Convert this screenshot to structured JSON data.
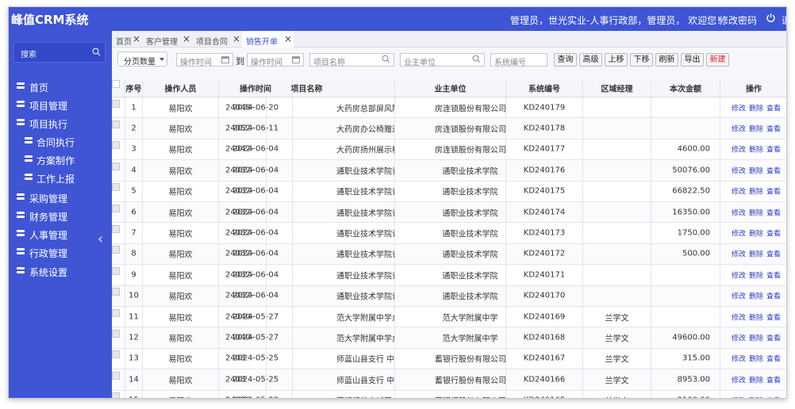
{
  "app": {
    "title": "峰值CRM系统",
    "user_info": "管理员，世光实业-人事行政部，管理员， 欢迎您！",
    "change_password": "修改密码",
    "logout": "退"
  },
  "sidebar": {
    "search_label": "搜索",
    "items": [
      {
        "label": "首页",
        "level": 1
      },
      {
        "label": "项目管理",
        "level": 1
      },
      {
        "label": "项目执行",
        "level": 1
      },
      {
        "label": "合同执行",
        "level": 2
      },
      {
        "label": "方案制作",
        "level": 2
      },
      {
        "label": "工作上报",
        "level": 2
      },
      {
        "label": "采购管理",
        "level": 1
      },
      {
        "label": "财务管理",
        "level": 1
      },
      {
        "label": "人事管理",
        "level": 1
      },
      {
        "label": "行政管理",
        "level": 1
      },
      {
        "label": "系统设置",
        "level": 1
      }
    ]
  },
  "tabs": [
    {
      "label": "首页",
      "active": false
    },
    {
      "label": "客户管理",
      "active": false
    },
    {
      "label": "项目合同",
      "active": false
    },
    {
      "label": "销售开单",
      "active": true
    }
  ],
  "toolbar": {
    "page_size_label": "分页数量",
    "start_time_placeholder": "操作时间",
    "to_label": "到",
    "end_time_placeholder": "操作时间",
    "project_name_placeholder": "项目名称",
    "owner_unit_placeholder": "业主单位",
    "system_code_placeholder": "系统编号",
    "buttons": [
      "查询",
      "高级",
      "上移",
      "下移",
      "刷新",
      "导出",
      "新建"
    ]
  },
  "table": {
    "columns": [
      "序号",
      "操作人员",
      "操作时间",
      "项目名称",
      "业主单位",
      "系统编号",
      "区域经理",
      "本次金额",
      "操作"
    ],
    "actions": [
      "修改",
      "删除",
      "查看"
    ],
    "rows": [
      {
        "no": "1",
        "operator": "易阳欢",
        "time": "2024-06-20",
        "project_code": "24048-",
        "project_name": "大药房总部屏风隔老百",
        "owner": "房连锁股份有限公司",
        "code": "KD240179",
        "manager": "",
        "amount": ""
      },
      {
        "no": "2",
        "operator": "易阳欢",
        "time": "2024-06-11",
        "project_code": "24052-",
        "project_name": "大药房办公椅赠送老百",
        "owner": "房连锁股份有限公司",
        "code": "KD240178",
        "manager": "",
        "amount": ""
      },
      {
        "no": "3",
        "operator": "易阳欢",
        "time": "2024-06-04",
        "project_code": "24042-",
        "project_name": "大药房扬州展示柜老百",
        "owner": "房连锁股份有限公司",
        "code": "KD240177",
        "manager": "",
        "amount": "4600.00"
      },
      {
        "no": "4",
        "operator": "易阳欢",
        "time": "2024-06-04",
        "project_code": "24032-",
        "project_name": "通职业技术学院记",
        "owner": "通职业技术学院",
        "code": "KD240176",
        "manager": "",
        "amount": "50076.00"
      },
      {
        "no": "5",
        "operator": "易阳欢",
        "time": "2024-06-04",
        "project_code": "24032-",
        "project_name": "通职业技术学院记",
        "owner": "通职业技术学院",
        "code": "KD240175",
        "manager": "",
        "amount": "66822.50"
      },
      {
        "no": "6",
        "operator": "易阳欢",
        "time": "2024-06-04",
        "project_code": "24032-",
        "project_name": "通职业技术学院记",
        "owner": "通职业技术学院",
        "code": "KD240174",
        "manager": "",
        "amount": "16350.00"
      },
      {
        "no": "7",
        "operator": "易阳欢",
        "time": "2024-06-04",
        "project_code": "24032-",
        "project_name": "通职业技术学院记",
        "owner": "通职业技术学院",
        "code": "KD240173",
        "manager": "",
        "amount": "1750.00"
      },
      {
        "no": "8",
        "operator": "易阳欢",
        "time": "2024-06-04",
        "project_code": "24032-",
        "project_name": "通职业技术学院记",
        "owner": "通职业技术学院",
        "code": "KD240172",
        "manager": "",
        "amount": "500.00"
      },
      {
        "no": "9",
        "operator": "易阳欢",
        "time": "2024-06-04",
        "project_code": "24032-",
        "project_name": "通职业技术学院记",
        "owner": "通职业技术学院",
        "code": "KD240171",
        "manager": "",
        "amount": ""
      },
      {
        "no": "10",
        "operator": "易阳欢",
        "time": "2024-06-04",
        "project_code": "24032-",
        "project_name": "通职业技术学院记",
        "owner": "通职业技术学院",
        "code": "KD240170",
        "manager": "",
        "amount": ""
      },
      {
        "no": "11",
        "operator": "易阳欢",
        "time": "2024-05-27",
        "project_code": "24040-",
        "project_name": "范大学附属中学桌",
        "owner": "范大学附属中学",
        "code": "KD240169",
        "manager": "兰学文",
        "amount": ""
      },
      {
        "no": "12",
        "operator": "易阳欢",
        "time": "2024-05-27",
        "project_code": "24040-",
        "project_name": "范大学附属中学桌",
        "owner": "范大学附属中学",
        "code": "KD240168",
        "manager": "兰学文",
        "amount": "49600.00"
      },
      {
        "no": "13",
        "operator": "易阳欢",
        "time": "2024-05-25",
        "project_code": "2403",
        "project_name": "师蓝山县支行 中国",
        "owner": "蓄银行股份有限公司",
        "code": "KD240167",
        "manager": "兰学文",
        "amount": "315.00"
      },
      {
        "no": "14",
        "operator": "易阳欢",
        "time": "2024-05-25",
        "project_code": "2403",
        "project_name": "师蓝山县支行 中国",
        "owner": "蓄银行股份有限公司",
        "code": "KD240166",
        "manager": "兰学文",
        "amount": "8953.00"
      },
      {
        "no": "15",
        "operator": "易阳欢",
        "time": "2024-05-22",
        "project_code": "24020-",
        "project_name": "蓄银行娄底城区支中国",
        "owner": "蓄银行股份有限公司",
        "code": "KD240165",
        "manager": "兰学文",
        "amount": "2100.00"
      }
    ]
  }
}
